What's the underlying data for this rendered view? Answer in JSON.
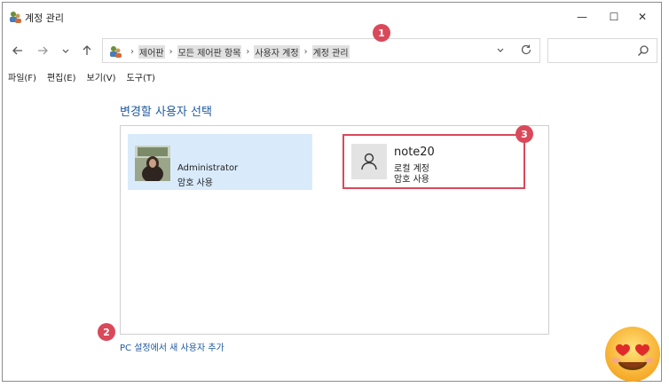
{
  "window": {
    "title": "계정 관리",
    "controls": {
      "minimize": "—",
      "maximize": "☐",
      "close": "✕"
    }
  },
  "address": {
    "breadcrumbs": [
      "제어판",
      "모든 제어판 항목",
      "사용자 계정",
      "계정 관리"
    ],
    "separator": "›"
  },
  "menu": [
    "파일(F)",
    "편집(E)",
    "보기(V)",
    "도구(T)"
  ],
  "main": {
    "heading": "변경할 사용자 선택",
    "users": [
      {
        "name": "Administrator",
        "type": "암호 사용"
      },
      {
        "name": "note20",
        "sub1": "로컬 계정",
        "sub2": "암호 사용"
      }
    ],
    "add_link": "PC 설정에서 새 사용자 추가"
  },
  "annotations": {
    "badge1": "1",
    "badge2": "2",
    "badge3": "3"
  },
  "colors": {
    "accent": "#1e5aa0",
    "selected_bg": "#d9ebfb",
    "highlight_border": "#d9495a"
  }
}
